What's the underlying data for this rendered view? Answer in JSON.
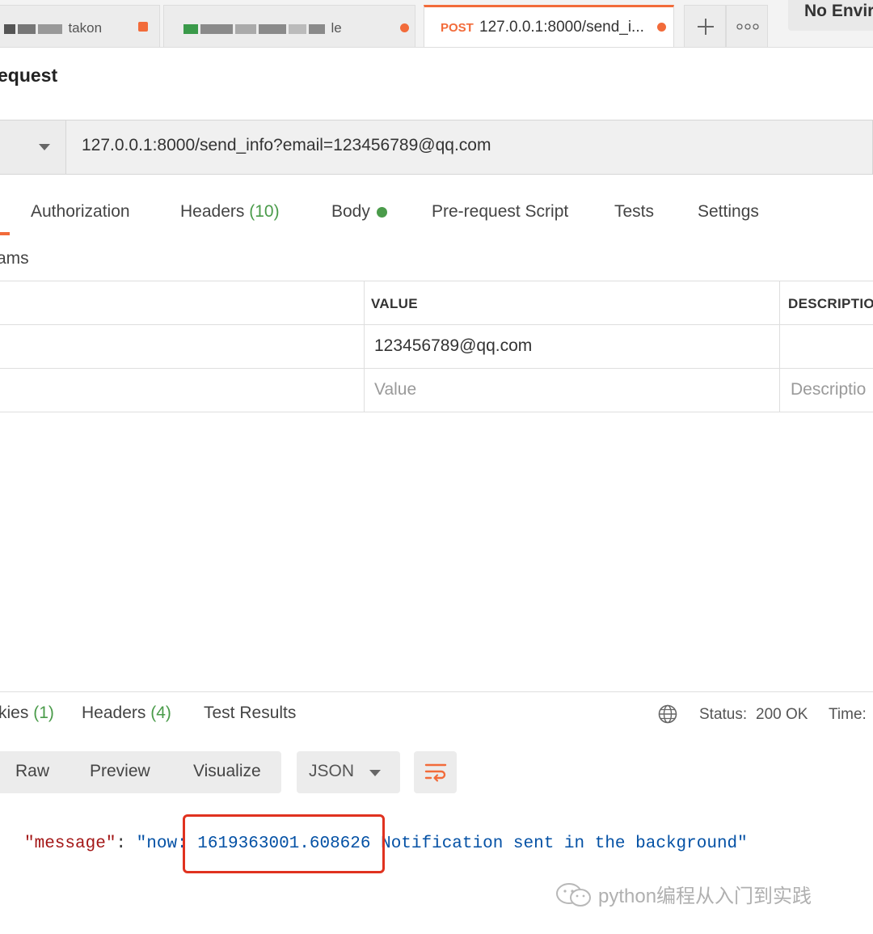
{
  "tabs": [
    {
      "label_fragment": "takon",
      "dirty": true
    },
    {
      "label_fragment": "le",
      "dirty": true
    },
    {
      "method": "POST",
      "label": "127.0.0.1:8000/send_i...",
      "dirty": true,
      "active": true
    }
  ],
  "environment": {
    "label": "No Envir"
  },
  "request": {
    "title": "equest",
    "url": "127.0.0.1:8000/send_info?email=123456789@qq.com"
  },
  "request_tabs": {
    "authorization": "Authorization",
    "headers": "Headers",
    "headers_count": "(10)",
    "body": "Body",
    "pre_request": "Pre-request Script",
    "tests": "Tests",
    "settings": "Settings"
  },
  "params": {
    "section_label": "ams",
    "columns": {
      "value": "VALUE",
      "description": "DESCRIPTIO"
    },
    "rows": [
      {
        "value": "123456789@qq.com",
        "description": ""
      }
    ],
    "placeholder_row": {
      "value": "Value",
      "description": "Descriptio"
    }
  },
  "response_tabs": {
    "cookies": "kies",
    "cookies_count": "(1)",
    "headers": "Headers",
    "headers_count": "(4)",
    "test_results": "Test Results"
  },
  "status": {
    "label": "Status:",
    "value": "200 OK",
    "time_label": "Time:"
  },
  "view_modes": [
    "Raw",
    "Preview",
    "Visualize"
  ],
  "format": {
    "selected": "JSON"
  },
  "response_body": {
    "key": "\"message\"",
    "colon": ": ",
    "value": "\"now: 1619363001.608626 Notification sent in the background\""
  },
  "watermark": {
    "text": "python编程从入门到实践"
  },
  "colors": {
    "accent": "#f26b3a",
    "success": "#4a9b4a",
    "highlight": "#e0321f",
    "json_key": "#a31515",
    "json_string": "#0451a5"
  }
}
